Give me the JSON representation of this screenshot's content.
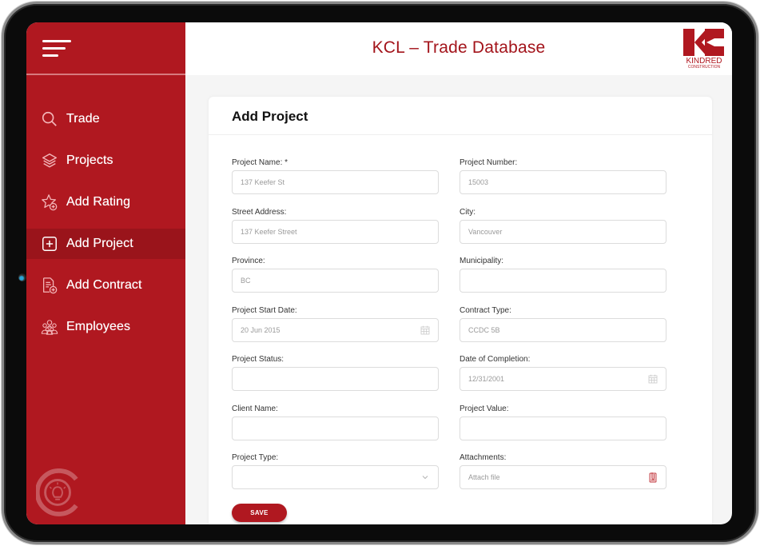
{
  "app": {
    "title": "KCL – Trade Database",
    "brand": {
      "name": "KINDRED",
      "subtitle": "CONSTRUCTION"
    }
  },
  "colors": {
    "primary": "#b01820",
    "primary_dark": "#9a141b",
    "title": "#a3141b"
  },
  "sidebar": {
    "items": [
      {
        "label": "Trade",
        "icon": "search-icon",
        "active": false
      },
      {
        "label": "Projects",
        "icon": "layers-icon",
        "active": false
      },
      {
        "label": "Add Rating",
        "icon": "star-add-icon",
        "active": false
      },
      {
        "label": "Add Project",
        "icon": "plus-square-icon",
        "active": true
      },
      {
        "label": "Add Contract",
        "icon": "document-add-icon",
        "active": false
      },
      {
        "label": "Employees",
        "icon": "people-icon",
        "active": false
      }
    ]
  },
  "page": {
    "title": "Add Project"
  },
  "form": {
    "fields": [
      {
        "label": "Project Name: *",
        "placeholder": "137 Keefer St",
        "icon": ""
      },
      {
        "label": "Project Number:",
        "placeholder": "15003",
        "icon": ""
      },
      {
        "label": "Street Address:",
        "placeholder": "137 Keefer Street",
        "icon": ""
      },
      {
        "label": "City:",
        "placeholder": "Vancouver",
        "icon": ""
      },
      {
        "label": "Province:",
        "placeholder": "BC",
        "icon": ""
      },
      {
        "label": "Municipality:",
        "placeholder": "",
        "icon": ""
      },
      {
        "label": "Project Start Date:",
        "placeholder": "20 Jun 2015",
        "icon": "calendar-icon"
      },
      {
        "label": "Contract Type:",
        "placeholder": "CCDC 5B",
        "icon": ""
      },
      {
        "label": "Project Status:",
        "placeholder": "",
        "icon": ""
      },
      {
        "label": "Date of Completion:",
        "placeholder": "12/31/2001",
        "icon": "calendar-icon"
      },
      {
        "label": "Client Name:",
        "placeholder": "",
        "icon": ""
      },
      {
        "label": "Project Value:",
        "placeholder": "",
        "icon": ""
      },
      {
        "label": "Project Type:",
        "placeholder": "",
        "icon": "chevron-down-icon"
      },
      {
        "label": "Attachments:",
        "placeholder": "Attach file",
        "icon": "attachment-icon"
      }
    ],
    "save_label": "SAVE"
  }
}
